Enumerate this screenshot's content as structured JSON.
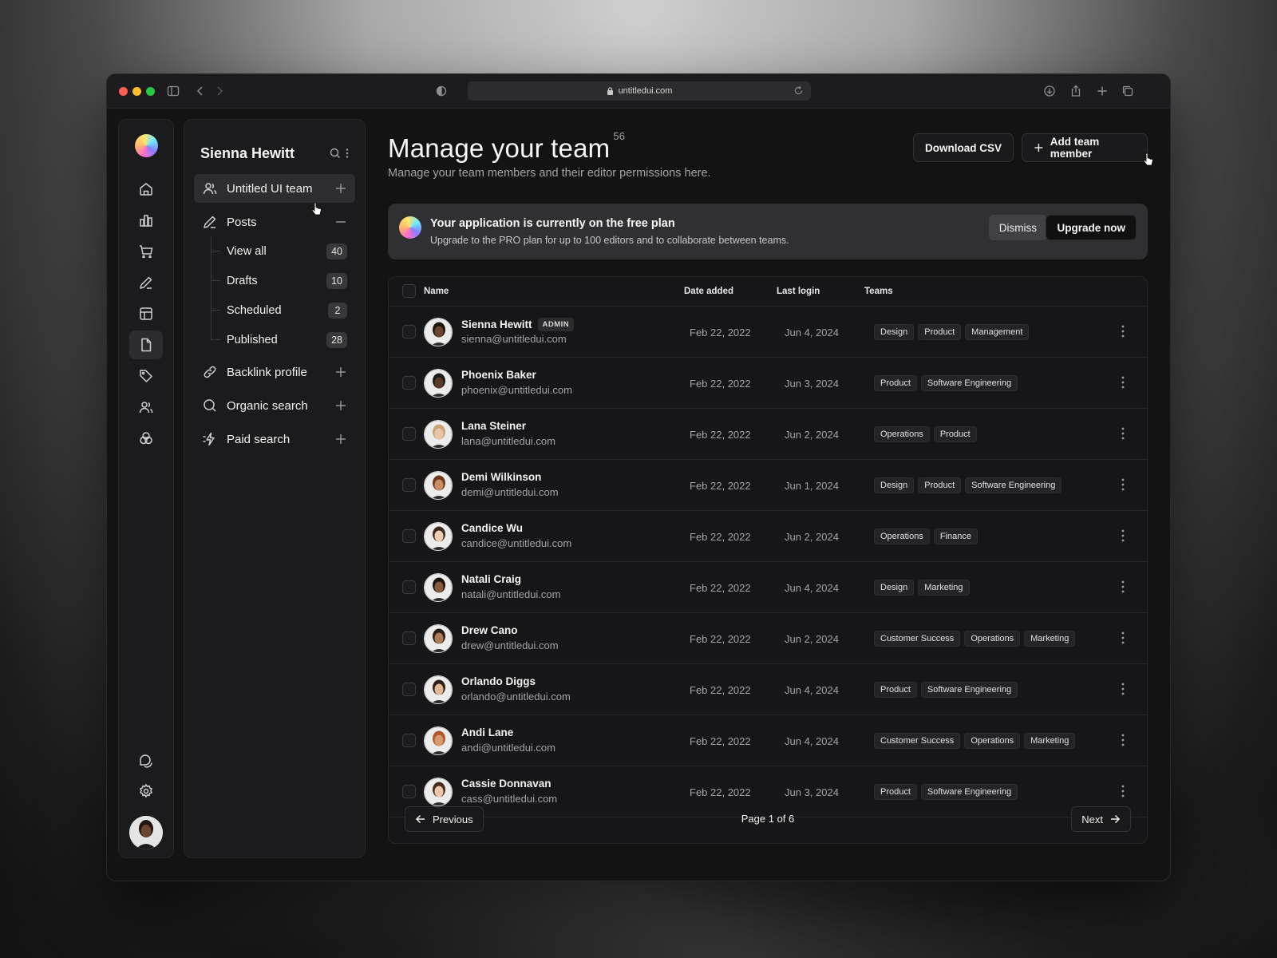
{
  "browser": {
    "url": "untitledui.com"
  },
  "rail": {
    "icons": [
      "home-icon",
      "bar-chart-icon",
      "shopping-cart-icon",
      "pen-icon",
      "layout-icon",
      "file-icon",
      "tag-icon",
      "users-icon",
      "circles-icon"
    ],
    "bottom_icons": [
      "support-icon",
      "settings-icon"
    ]
  },
  "sidebar": {
    "user_name": "Sienna Hewitt",
    "team": {
      "label": "Untitled UI team"
    },
    "posts": {
      "label": "Posts",
      "items": [
        {
          "label": "View all",
          "count": "40"
        },
        {
          "label": "Drafts",
          "count": "10"
        },
        {
          "label": "Scheduled",
          "count": "2"
        },
        {
          "label": "Published",
          "count": "28"
        }
      ]
    },
    "other": [
      {
        "label": "Backlink profile"
      },
      {
        "label": "Organic search"
      },
      {
        "label": "Paid search"
      }
    ]
  },
  "header": {
    "title": "Manage your team",
    "count": "56",
    "subtitle": "Manage your team members and their editor permissions here.",
    "download_label": "Download CSV",
    "add_label": "Add team member"
  },
  "banner": {
    "title": "Your application is currently on the free plan",
    "text": "Upgrade to the PRO plan for up to 100 editors and to collaborate between teams.",
    "dismiss_label": "Dismiss",
    "upgrade_label": "Upgrade now"
  },
  "table": {
    "columns": {
      "name": "Name",
      "date_added": "Date added",
      "last_login": "Last login",
      "teams": "Teams"
    },
    "admin_label": "ADMIN",
    "rows": [
      {
        "name": "Sienna Hewitt",
        "email": "sienna@untitledui.com",
        "date_added": "Feb 22, 2022",
        "last_login": "Jun 4, 2024",
        "teams": [
          "Design",
          "Product",
          "Management"
        ],
        "admin": true
      },
      {
        "name": "Phoenix Baker",
        "email": "phoenix@untitledui.com",
        "date_added": "Feb 22, 2022",
        "last_login": "Jun 3, 2024",
        "teams": [
          "Product",
          "Software Engineering"
        ]
      },
      {
        "name": "Lana Steiner",
        "email": "lana@untitledui.com",
        "date_added": "Feb 22, 2022",
        "last_login": "Jun 2, 2024",
        "teams": [
          "Operations",
          "Product"
        ]
      },
      {
        "name": "Demi Wilkinson",
        "email": "demi@untitledui.com",
        "date_added": "Feb 22, 2022",
        "last_login": "Jun 1, 2024",
        "teams": [
          "Design",
          "Product",
          "Software Engineering"
        ]
      },
      {
        "name": "Candice Wu",
        "email": "candice@untitledui.com",
        "date_added": "Feb 22, 2022",
        "last_login": "Jun 2, 2024",
        "teams": [
          "Operations",
          "Finance"
        ]
      },
      {
        "name": "Natali Craig",
        "email": "natali@untitledui.com",
        "date_added": "Feb 22, 2022",
        "last_login": "Jun 4, 2024",
        "teams": [
          "Design",
          "Marketing"
        ]
      },
      {
        "name": "Drew Cano",
        "email": "drew@untitledui.com",
        "date_added": "Feb 22, 2022",
        "last_login": "Jun 2, 2024",
        "teams": [
          "Customer Success",
          "Operations",
          "Marketing"
        ]
      },
      {
        "name": "Orlando Diggs",
        "email": "orlando@untitledui.com",
        "date_added": "Feb 22, 2022",
        "last_login": "Jun 4, 2024",
        "teams": [
          "Product",
          "Software Engineering"
        ]
      },
      {
        "name": "Andi Lane",
        "email": "andi@untitledui.com",
        "date_added": "Feb 22, 2022",
        "last_login": "Jun 4, 2024",
        "teams": [
          "Customer Success",
          "Operations",
          "Marketing"
        ]
      },
      {
        "name": "Cassie Donnavan",
        "email": "cass@untitledui.com",
        "date_added": "Feb 22, 2022",
        "last_login": "Jun 3, 2024",
        "teams": [
          "Product",
          "Software Engineering"
        ]
      }
    ]
  },
  "pagination": {
    "previous_label": "Previous",
    "page_label": "Page 1 of 6",
    "next_label": "Next"
  }
}
